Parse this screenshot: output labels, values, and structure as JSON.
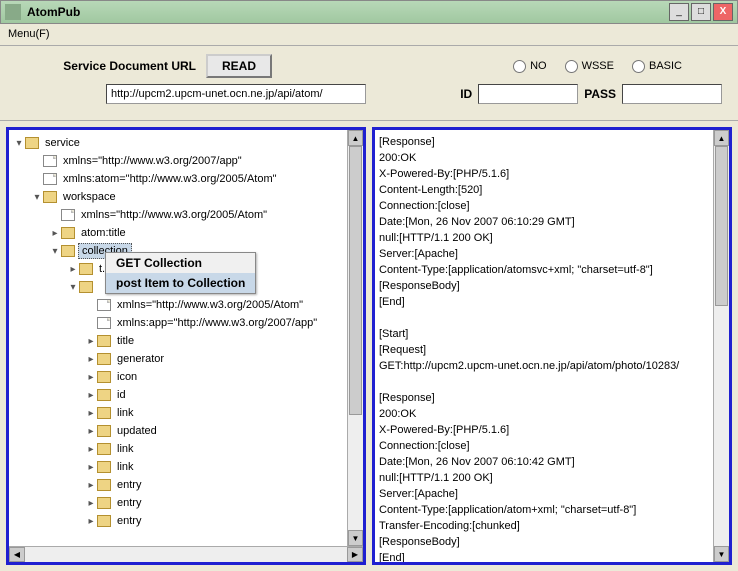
{
  "window": {
    "title": "AtomPub"
  },
  "menubar": {
    "menu": "Menu(F)"
  },
  "toolbar": {
    "url_label": "Service Document URL",
    "read_btn": "READ",
    "url_value": "http://upcm2.upcm-unet.ocn.ne.jp/api/atom/",
    "auth": {
      "no": "NO",
      "wsse": "WSSE",
      "basic": "BASIC"
    },
    "id_label": "ID",
    "id_value": "",
    "pass_label": "PASS",
    "pass_value": ""
  },
  "tree": [
    {
      "d": 0,
      "exp": "▾",
      "i": "f",
      "t": "service"
    },
    {
      "d": 1,
      "exp": "",
      "i": "d",
      "t": "xmlns=\"http://www.w3.org/2007/app\""
    },
    {
      "d": 1,
      "exp": "",
      "i": "d",
      "t": "xmlns:atom=\"http://www.w3.org/2005/Atom\""
    },
    {
      "d": 1,
      "exp": "▾",
      "i": "f",
      "t": "workspace"
    },
    {
      "d": 2,
      "exp": "",
      "i": "d",
      "t": "xmlns=\"http://www.w3.org/2005/Atom\""
    },
    {
      "d": 2,
      "exp": "▸",
      "i": "f",
      "t": "atom:title"
    },
    {
      "d": 2,
      "exp": "▾",
      "i": "f",
      "t": "collection",
      "sel": true
    },
    {
      "d": 3,
      "exp": "▸",
      "i": "f",
      "t": "                                            t.ocn.ne.jp/api/atom/phot"
    },
    {
      "d": 3,
      "exp": "▾",
      "i": "f",
      "t": ""
    },
    {
      "d": 4,
      "exp": "",
      "i": "d",
      "t": "xmlns=\"http://www.w3.org/2005/Atom\""
    },
    {
      "d": 4,
      "exp": "",
      "i": "d",
      "t": "xmlns:app=\"http://www.w3.org/2007/app\""
    },
    {
      "d": 4,
      "exp": "▸",
      "i": "f",
      "t": "title"
    },
    {
      "d": 4,
      "exp": "▸",
      "i": "f",
      "t": "generator"
    },
    {
      "d": 4,
      "exp": "▸",
      "i": "f",
      "t": "icon"
    },
    {
      "d": 4,
      "exp": "▸",
      "i": "f",
      "t": "id"
    },
    {
      "d": 4,
      "exp": "▸",
      "i": "f",
      "t": "link"
    },
    {
      "d": 4,
      "exp": "▸",
      "i": "f",
      "t": "updated"
    },
    {
      "d": 4,
      "exp": "▸",
      "i": "f",
      "t": "link"
    },
    {
      "d": 4,
      "exp": "▸",
      "i": "f",
      "t": "link"
    },
    {
      "d": 4,
      "exp": "▸",
      "i": "f",
      "t": "entry"
    },
    {
      "d": 4,
      "exp": "▸",
      "i": "f",
      "t": "entry"
    },
    {
      "d": 4,
      "exp": "▸",
      "i": "f",
      "t": "entry"
    }
  ],
  "ctx_menu": {
    "item1": "GET Collection",
    "item2": "post Item to Collection"
  },
  "response": [
    "[Response]",
    "200:OK",
    "X-Powered-By:[PHP/5.1.6]",
    "Content-Length:[520]",
    "Connection:[close]",
    "Date:[Mon, 26 Nov 2007 06:10:29 GMT]",
    "null:[HTTP/1.1 200 OK]",
    "Server:[Apache]",
    "Content-Type:[application/atomsvc+xml; \"charset=utf-8\"]",
    "[ResponseBody]",
    "[End]",
    "",
    "[Start]",
    "[Request]",
    "GET:http://upcm2.upcm-unet.ocn.ne.jp/api/atom/photo/10283/",
    "",
    "[Response]",
    "200:OK",
    "X-Powered-By:[PHP/5.1.6]",
    "Connection:[close]",
    "Date:[Mon, 26 Nov 2007 06:10:42 GMT]",
    "null:[HTTP/1.1 200 OK]",
    "Server:[Apache]",
    "Content-Type:[application/atom+xml; \"charset=utf-8\"]",
    "Transfer-Encoding:[chunked]",
    "[ResponseBody]",
    "[End]"
  ]
}
